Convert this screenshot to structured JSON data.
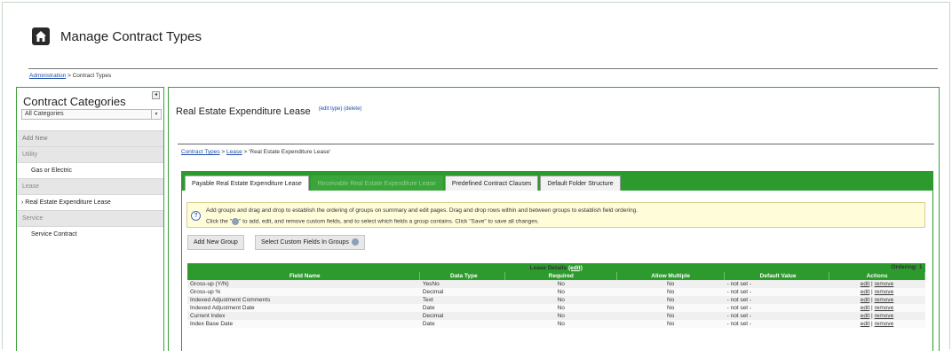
{
  "header": {
    "title": "Manage Contract Types",
    "icon": "home-icon"
  },
  "breadcrumb_top": {
    "admin": "Administration",
    "sep": " > ",
    "current": "Contract Types"
  },
  "sidebar": {
    "title": "Contract Categories",
    "collapse": "◂",
    "category_select": "All Categories",
    "add_new": "Add New",
    "sections": [
      {
        "label": "Utility",
        "items": [
          "Gas or Electric"
        ]
      },
      {
        "label": "Lease",
        "items": [
          "› Real Estate Expenditure Lease"
        ]
      },
      {
        "label": "Service",
        "items": [
          "Service Contract"
        ]
      }
    ]
  },
  "main": {
    "title": "Real Estate Expenditure Lease",
    "edit_type": "(edit type)",
    "delete": "(delete)",
    "breadcrumb": {
      "types": "Contract Types",
      "sep": " > ",
      "lease": "Lease",
      "current": " > 'Real Estate Expenditure Lease'"
    },
    "tabs": [
      {
        "label": "Payable Real Estate Expenditure Lease",
        "state": "active"
      },
      {
        "label": "Receivable Real Estate Expenditure Lease",
        "state": "green"
      },
      {
        "label": "Predefined Contract Clauses",
        "state": "normal"
      },
      {
        "label": "Default Folder Structure",
        "state": "normal"
      }
    ],
    "info": {
      "line1": "Add groups and drag and drop to establish the ordering of groups on summary and edit pages. Drag and drop rows within and between groups to establish field ordering.",
      "line2_a": "Click the \"",
      "line2_b": "\" to add, edit, and remove custom fields, and to select which fields a group contains. Click \"Save\" to save all changes."
    },
    "buttons": {
      "add_group": "Add New Group",
      "select_fields": "Select Custom Fields In Groups"
    },
    "group": {
      "title": "Lease Details",
      "edit": "(edit)",
      "ordering": "Ordering: 1",
      "columns": [
        "Field Name",
        "Data Type",
        "Required",
        "Allow Multiple",
        "Default Value",
        "Actions"
      ],
      "rows": [
        {
          "name": "Gross-up (Y/N)",
          "type": "YesNo",
          "required": "No",
          "multiple": "No",
          "default": "- not set -"
        },
        {
          "name": "Gross-up %",
          "type": "Decimal",
          "required": "No",
          "multiple": "No",
          "default": "- not set -"
        },
        {
          "name": "Indexed Adjustment Comments",
          "type": "Text",
          "required": "No",
          "multiple": "No",
          "default": "- not set -"
        },
        {
          "name": "Indexed Adjustment Date",
          "type": "Date",
          "required": "No",
          "multiple": "No",
          "default": "- not set -"
        },
        {
          "name": "Current Index",
          "type": "Decimal",
          "required": "No",
          "multiple": "No",
          "default": "- not set -"
        },
        {
          "name": "Index Base Date",
          "type": "Date",
          "required": "No",
          "multiple": "No",
          "default": "- not set -"
        }
      ],
      "action_edit": "edit",
      "action_sep": " | ",
      "action_remove": "remove"
    }
  },
  "colors": {
    "accent_green": "#2c9a2c",
    "link_blue": "#1f4fa8",
    "info_bg": "#fffcd9"
  }
}
